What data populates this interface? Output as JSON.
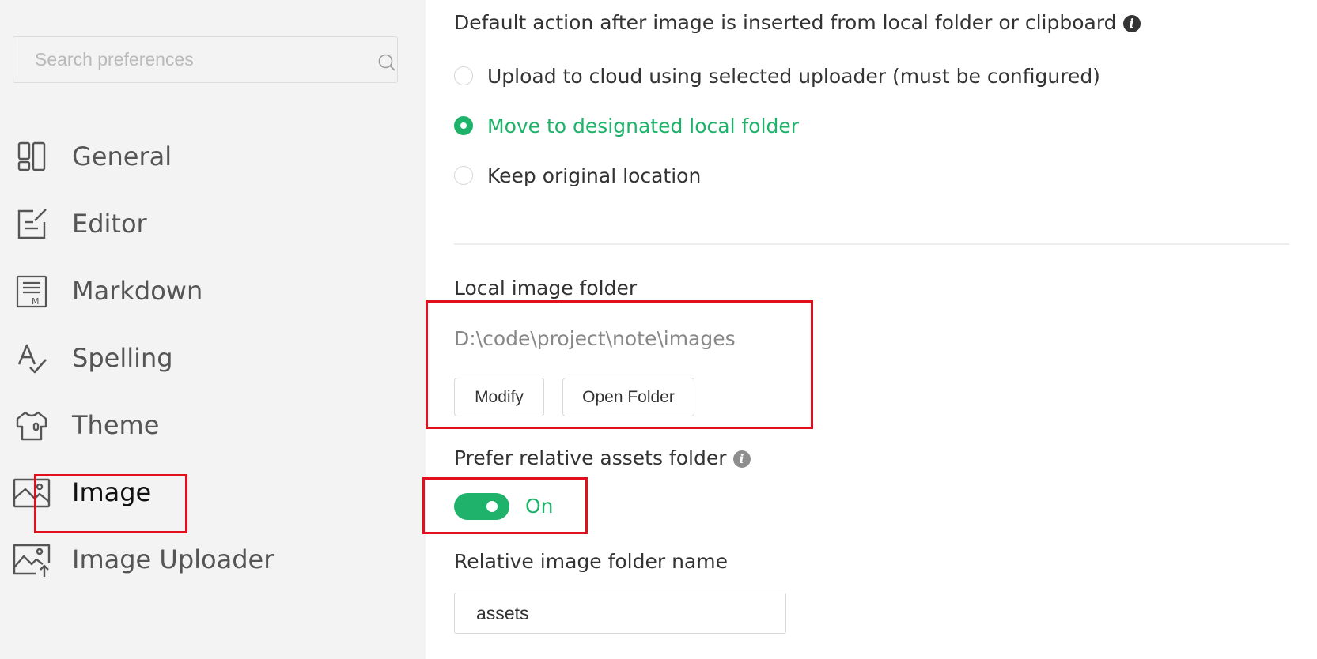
{
  "sidebar": {
    "search": {
      "placeholder": "Search preferences",
      "value": "",
      "icon": "search-icon"
    },
    "items": [
      {
        "key": "general",
        "label": "General",
        "icon": "layout-icon",
        "active": false
      },
      {
        "key": "editor",
        "label": "Editor",
        "icon": "edit-icon",
        "active": false
      },
      {
        "key": "markdown",
        "label": "Markdown",
        "icon": "markdown-doc-icon",
        "active": false
      },
      {
        "key": "spelling",
        "label": "Spelling",
        "icon": "spellcheck-icon",
        "active": false
      },
      {
        "key": "theme",
        "label": "Theme",
        "icon": "shirt-icon",
        "active": false
      },
      {
        "key": "image",
        "label": "Image",
        "icon": "image-icon",
        "active": true
      },
      {
        "key": "image-uploader",
        "label": "Image Uploader",
        "icon": "image-upload-icon",
        "active": false
      }
    ]
  },
  "main": {
    "default_action": {
      "label": "Default action after image is inserted from local folder or clipboard",
      "info_icon": "info-icon",
      "options": [
        {
          "label": "Upload to cloud using selected uploader (must be configured)",
          "checked": false
        },
        {
          "label": "Move to designated local folder",
          "checked": true
        },
        {
          "label": "Keep original location",
          "checked": false
        }
      ]
    },
    "local_folder": {
      "label": "Local image folder",
      "path": "D:\\code\\project\\note\\images",
      "modify_label": "Modify",
      "open_label": "Open Folder"
    },
    "prefer_relative": {
      "label": "Prefer relative assets folder",
      "info_icon": "info-icon",
      "toggle_on": true,
      "toggle_label": "On"
    },
    "relative_folder": {
      "label": "Relative image folder name",
      "value": "assets"
    }
  },
  "colors": {
    "accent": "#1eb26a",
    "sidebar_bg": "#f3f3f3",
    "highlight": "#e1101c"
  }
}
